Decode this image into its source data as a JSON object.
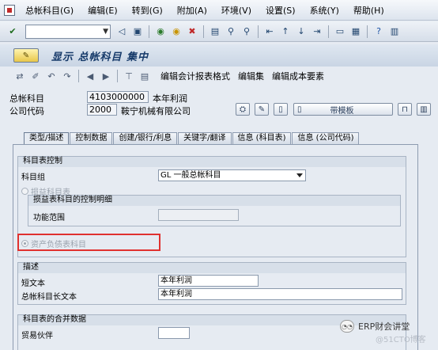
{
  "menubar": {
    "items": [
      "总帐科目(G)",
      "编辑(E)",
      "转到(G)",
      "附加(A)",
      "环境(V)",
      "设置(S)",
      "系统(Y)",
      "帮助(H)"
    ]
  },
  "toolbar": {
    "command_field": "",
    "icons": [
      "enter-icon",
      "back-icon",
      "save-icon",
      "exit-icon",
      "cancel-icon",
      "print-icon",
      "find-icon",
      "find-next-icon",
      "first-page-icon",
      "prev-page-icon",
      "next-page-icon",
      "last-page-icon",
      "new-session-icon",
      "shortcut-icon",
      "help-icon",
      "layout-icon"
    ]
  },
  "title": {
    "text": "显示 总帐科目 集中"
  },
  "app_toolbar": {
    "btn_edit_report_format": "编辑会计报表格式",
    "btn_edit_set": "编辑集",
    "btn_edit_cost_element": "编辑成本要素"
  },
  "header": {
    "gl_account_label": "总帐科目",
    "gl_account_value": "4103000000",
    "gl_account_desc": "本年利润",
    "company_code_label": "公司代码",
    "company_code_value": "2000",
    "company_name": "鞍宁机械有限公司",
    "template_button": "带模板"
  },
  "tabs": [
    {
      "label": "类型/描述",
      "active": true
    },
    {
      "label": "控制数据",
      "active": false
    },
    {
      "label": "创建/银行/利息",
      "active": false
    },
    {
      "label": "关键字/翻译",
      "active": false
    },
    {
      "label": "信息 (科目表)",
      "active": false
    },
    {
      "label": "信息 (公司代码)",
      "active": false
    }
  ],
  "control_group": {
    "title": "科目表控制",
    "account_group_label": "科目组",
    "account_group_value": "GL 一般总帐科目",
    "pl_radio_label": "损益科目表",
    "pl_detail_title": "损益表科目的控制明细",
    "functional_area_label": "功能范围",
    "functional_area_value": "",
    "bs_radio_label": "资产负债表科目"
  },
  "description_group": {
    "title": "描述",
    "short_text_label": "短文本",
    "short_text_value": "本年利润",
    "long_text_label": "总帐科目长文本",
    "long_text_value": "本年利润"
  },
  "consolidation_group": {
    "title": "科目表的合并数据",
    "trading_partner_label": "贸易伙伴",
    "trading_partner_value": ""
  },
  "watermark": {
    "text": "ERP财会讲堂",
    "faint_text": "@51CTO博客"
  },
  "colors": {
    "highlight_border": "#e0312f",
    "title_text": "#163a6a"
  }
}
